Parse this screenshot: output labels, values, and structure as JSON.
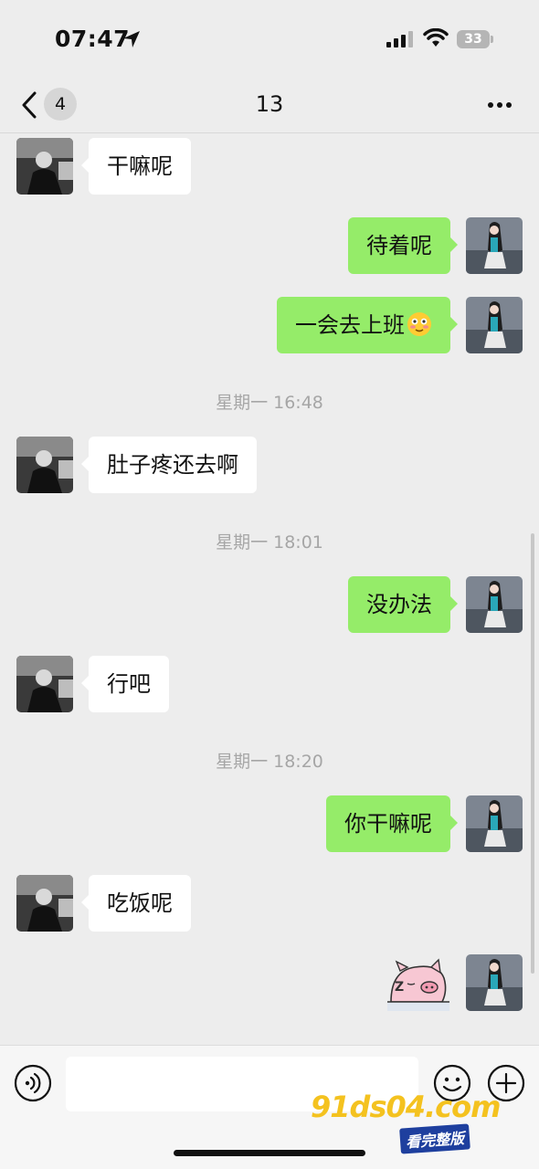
{
  "status_bar": {
    "time": "07:47",
    "battery": "33"
  },
  "nav": {
    "unread_count": "4",
    "title": "13"
  },
  "messages": [
    {
      "side": "left",
      "text": "干嘛呢"
    },
    {
      "side": "right",
      "text": "待着呢"
    },
    {
      "side": "right",
      "text": "一会去上班",
      "emoji": "flushed-face-emoji"
    },
    {
      "type": "timestamp",
      "text": "星期一 16:48"
    },
    {
      "side": "left",
      "text": "肚子疼还去啊"
    },
    {
      "type": "timestamp",
      "text": "星期一 18:01"
    },
    {
      "side": "right",
      "text": "没办法"
    },
    {
      "side": "left",
      "text": "行吧"
    },
    {
      "type": "timestamp",
      "text": "星期一 18:20"
    },
    {
      "side": "right",
      "text": "你干嘛呢"
    },
    {
      "side": "left",
      "text": "吃饭呢"
    },
    {
      "side": "right",
      "type": "sticker",
      "sticker": "sleeping-pig-sticker"
    }
  ],
  "input_bar": {
    "text_value": ""
  },
  "watermark": {
    "main": "91ds04.com",
    "sub": "看完整版"
  },
  "colors": {
    "background": "#ededed",
    "own_bubble": "#95ec69",
    "other_bubble": "#ffffff",
    "timestamp": "#a6a6a6"
  }
}
